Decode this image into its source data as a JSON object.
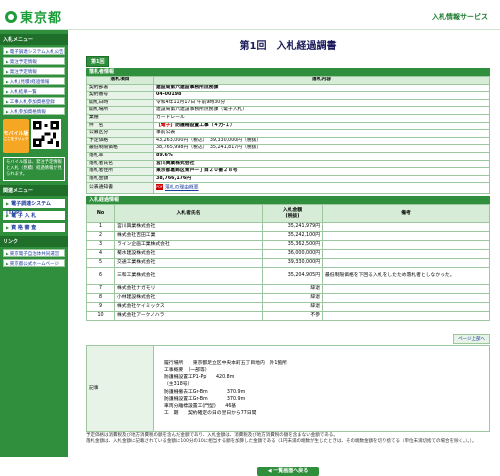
{
  "header": {
    "logo_text": "東京都",
    "service": "入札情報サービス"
  },
  "sidebar": {
    "menu_title": "入札メニュー",
    "links": [
      "電子調達システム入札公告",
      "発注予定情報",
      "発注予定情報",
      "入札(見積)経過情報",
      "入札結果一覧",
      "工事入札参加資格登録",
      "入札参加資格情報"
    ],
    "mobile_label": "モバイル版",
    "mobile_sub": "ここをクリック",
    "note": "モバイル版は、発注予定情報と入札（見積）経過情報が見られます。",
    "lower_title": "関連メニュー",
    "buttons": [
      "電子調達システム(TOP)",
      "電 子 入 札",
      "資 格 審 査"
    ],
    "link_title": "リンク",
    "bottom_links": [
      "東京電子自治体共同運営",
      "東京都公式ホームページ"
    ]
  },
  "page": {
    "title": "第1回　入札経過調書",
    "tab": "第1回"
  },
  "sections": {
    "info": "落札者情報",
    "bid": "入札経過情報"
  },
  "info": {
    "col_item": "落札項目",
    "col_content": "落札内容",
    "rows": [
      {
        "label": "契約部署",
        "value": "建設局第六建設事務所庶務課",
        "style": "bold"
      },
      {
        "label": "契約番号",
        "value": "04-00198",
        "style": "bold"
      },
      {
        "label": "開札日時",
        "value": "令和4年11月17日 午前9時30分",
        "style": ""
      },
      {
        "label": "開札場所",
        "value": "建設局第六建設事務所庶務課（電子入札）",
        "style": ""
      },
      {
        "label": "業種",
        "value": "ガードレール",
        "style": ""
      },
      {
        "label": "件　名",
        "value": "",
        "style": "name"
      },
      {
        "label": "公募区分",
        "value": "事前公表",
        "style": ""
      },
      {
        "label": "予定価格",
        "value": "43,263,000円（税込）　39,330,000円（税抜）",
        "style": ""
      },
      {
        "label": "最低制限価格",
        "value": "38,765,998円（税込）　35,241,817円（税抜）",
        "style": ""
      },
      {
        "label": "落札率",
        "value": "89.6%",
        "style": "bold"
      },
      {
        "label": "落札者氏名",
        "value": "宮川興業株式会社",
        "style": "bold"
      },
      {
        "label": "落札者住所",
        "value": "東京都葛飾区青戸一丁目２０番２８号",
        "style": "bold"
      },
      {
        "label": "落札金額",
        "value": "38,766,176円",
        "style": "bold"
      }
    ],
    "name_tag": "【電子】",
    "name_text": "防護柵設置工事（４力-１）",
    "notice_label": "公表通知書",
    "notice_link": "落札の理由概要",
    "pdf_icon": "PDF"
  },
  "bid": {
    "headers": [
      "No",
      "入札者氏名",
      "入札金額\n(税抜)",
      "備考"
    ],
    "rows": [
      {
        "no": "1",
        "name": "宮川興業株式会社",
        "amount": "35,241,979円",
        "note": ""
      },
      {
        "no": "2",
        "name": "株式会社吉田工業",
        "amount": "35,242,100円",
        "note": ""
      },
      {
        "no": "3",
        "name": "ライン企画工業株式会社",
        "amount": "35,362,500円",
        "note": ""
      },
      {
        "no": "4",
        "name": "菊水建設株式会社",
        "amount": "36,000,000円",
        "note": ""
      },
      {
        "no": "5",
        "name": "交通工業株式会社",
        "amount": "39,330,000円",
        "note": ""
      },
      {
        "no": "6",
        "name": "三和工業株式会社",
        "amount": "35,204,905円",
        "note": "最低制限価格を下回る入札をしたため落札者としなかった。"
      },
      {
        "no": "7",
        "name": "株式会社ナガモリ",
        "amount": "辞退",
        "note": ""
      },
      {
        "no": "8",
        "name": "小林建設株式会社",
        "amount": "辞退",
        "note": ""
      },
      {
        "no": "9",
        "name": "株式会社ケイミックス",
        "amount": "辞退",
        "note": ""
      },
      {
        "no": "10",
        "name": "株式会社アークノハラ",
        "amount": "不参",
        "note": ""
      }
    ],
    "reload": "ページ上部へ"
  },
  "notes": {
    "label": "記事",
    "lines": [
      "履行場所　　東京都足立区中央本町五丁目地内　外1箇所",
      "工事概要　（一部等）",
      "防護柵設置工P1-Pp　　420.8m",
      "（主318号）",
      "防護柵撤去工Gr-Bm　　　　370.9m",
      "防護柵設置工Gr-Bm　　　　370.9m",
      "車両分離標設置工(門型)　　46基",
      "工　期　　契約確定の日の翌日から77日間"
    ]
  },
  "footer": {
    "line1": "予定価格は消費税及び地方消費税の額を含んだ金額であり、入札金額は、消費税及び地方消費税の額を含まない金額である。",
    "line2": "落札金額は、入札金額に記載されている金額に100分の10に相当する額を加算した金額である（1円未満の端数が生じたときは、その端数金額を切り捨てる（単位未満切捨ての場合を除く。）。）。",
    "back_button": "◀ 一覧画面へ戻る"
  }
}
